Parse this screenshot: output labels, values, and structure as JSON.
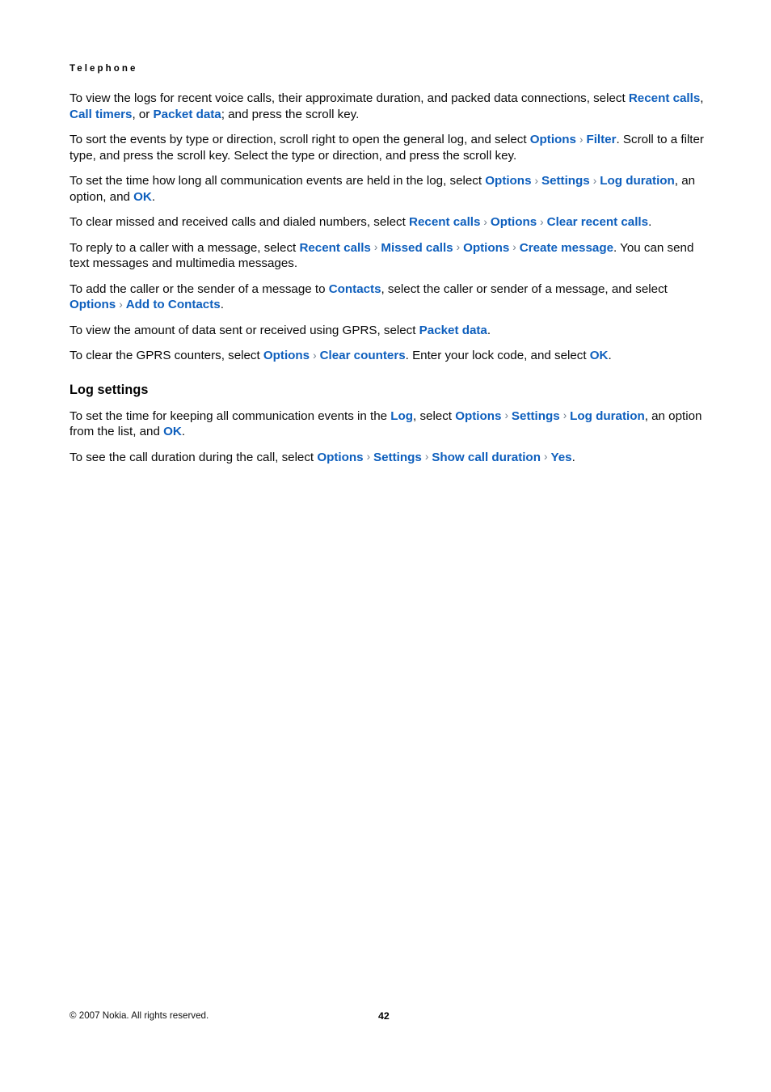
{
  "document": {
    "running_head": "Telephone",
    "page_number": "42",
    "copyright": "© 2007 Nokia. All rights reserved.",
    "link_color": "#0e5fbd",
    "text_color": "#0a0a0a",
    "separator_glyph": "›"
  },
  "paragraphs": {
    "p1": {
      "t1": "To view the logs for recent voice calls, their approximate duration, and packed data connections, select ",
      "l1": "Recent calls",
      "t2": ", ",
      "l2": "Call timers",
      "t3": ", or ",
      "l3": "Packet data",
      "t4": "; and press the scroll key."
    },
    "p2": {
      "t1": "To sort the events by type or direction, scroll right to open the general log, and select ",
      "l1": "Options",
      "l2": "Filter",
      "t2": ". Scroll to a filter type, and press the scroll key. Select the type or direction, and press the scroll key."
    },
    "p3": {
      "t1": "To set the time how long all communication events are held in the log, select ",
      "l1": "Options",
      "l2": "Settings",
      "l3": "Log duration",
      "t2": ", an option, and ",
      "l4": "OK",
      "t3": "."
    },
    "p4": {
      "t1": "To clear missed and received calls and dialed numbers, select ",
      "l1": "Recent calls",
      "l2": "Options",
      "l3": "Clear recent calls",
      "t2": "."
    },
    "p5": {
      "t1": "To reply to a caller with a message, select ",
      "l1": "Recent calls",
      "l2": "Missed calls",
      "l3": "Options",
      "l4": "Create message",
      "t2": ". You can send text messages and multimedia messages."
    },
    "p6": {
      "t1": "To add the caller or the sender of a message to ",
      "l1": "Contacts",
      "t2": ", select the caller or sender of a message, and select ",
      "l2": "Options",
      "l3": "Add to Contacts",
      "t3": "."
    },
    "p7": {
      "t1": "To view the amount of data sent or received using GPRS, select ",
      "l1": "Packet data",
      "t2": "."
    },
    "p8": {
      "t1": "To clear the GPRS counters, select ",
      "l1": "Options",
      "l2": "Clear counters",
      "t2": ". Enter your lock code, and select ",
      "l3": "OK",
      "t3": "."
    },
    "p9": {
      "t1": "To set the time for keeping all communication events in the ",
      "l1": "Log",
      "t2": ", select ",
      "l2": "Options",
      "l3": "Settings",
      "l4": "Log duration",
      "t3": ", an option from the list, and ",
      "l5": "OK",
      "t4": "."
    },
    "p10": {
      "t1": "To see the call duration during the call, select ",
      "l1": "Options",
      "l2": "Settings",
      "l3": "Show call duration",
      "l4": "Yes",
      "t2": "."
    }
  },
  "sections": {
    "log_settings_heading": "Log settings"
  }
}
